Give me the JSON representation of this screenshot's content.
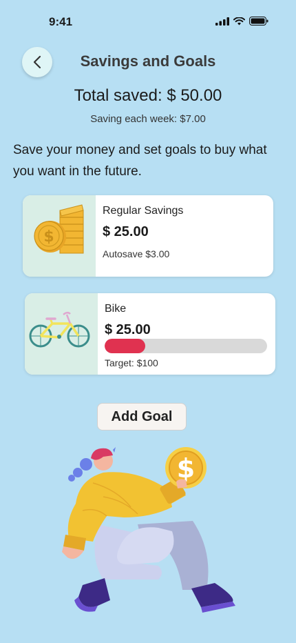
{
  "status": {
    "time": "9:41"
  },
  "header": {
    "title": "Savings and Goals"
  },
  "summary": {
    "total_saved": "Total saved: $ 50.00",
    "weekly": "Saving each week: $7.00"
  },
  "intro": "Save your money and set goals to buy what you want in the future.",
  "cards": {
    "regular": {
      "title": "Regular Savings",
      "amount": "$ 25.00",
      "sub": "Autosave $3.00"
    },
    "bike": {
      "title": "Bike",
      "amount": "$ 25.00",
      "target": "Target: $100",
      "progress_fraction": 0.25
    }
  },
  "actions": {
    "add_goal": "Add Goal"
  },
  "colors": {
    "background": "#b7dff3",
    "progress": "#e03250",
    "coin": "#f2b632"
  }
}
